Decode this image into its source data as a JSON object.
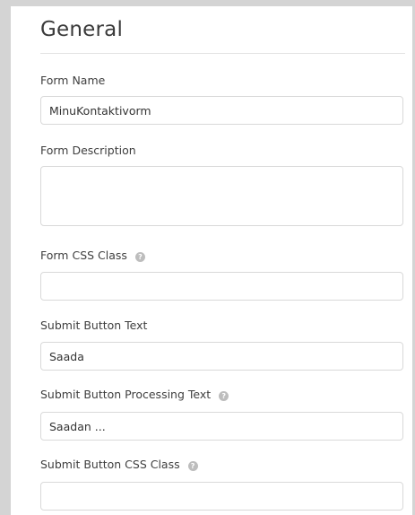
{
  "section": {
    "title": "General"
  },
  "fields": {
    "form_name": {
      "label": "Form Name",
      "value": "MinuKontaktivorm"
    },
    "form_description": {
      "label": "Form Description",
      "value": ""
    },
    "form_css_class": {
      "label": "Form CSS Class",
      "value": "",
      "help_icon": "help-circle-icon"
    },
    "submit_button_text": {
      "label": "Submit Button Text",
      "value": "Saada"
    },
    "submit_button_processing_text": {
      "label": "Submit Button Processing Text",
      "value": "Saadan ...",
      "help_icon": "help-circle-icon"
    },
    "submit_button_css_class": {
      "label": "Submit Button CSS Class",
      "value": "",
      "help_icon": "help-circle-icon"
    }
  }
}
